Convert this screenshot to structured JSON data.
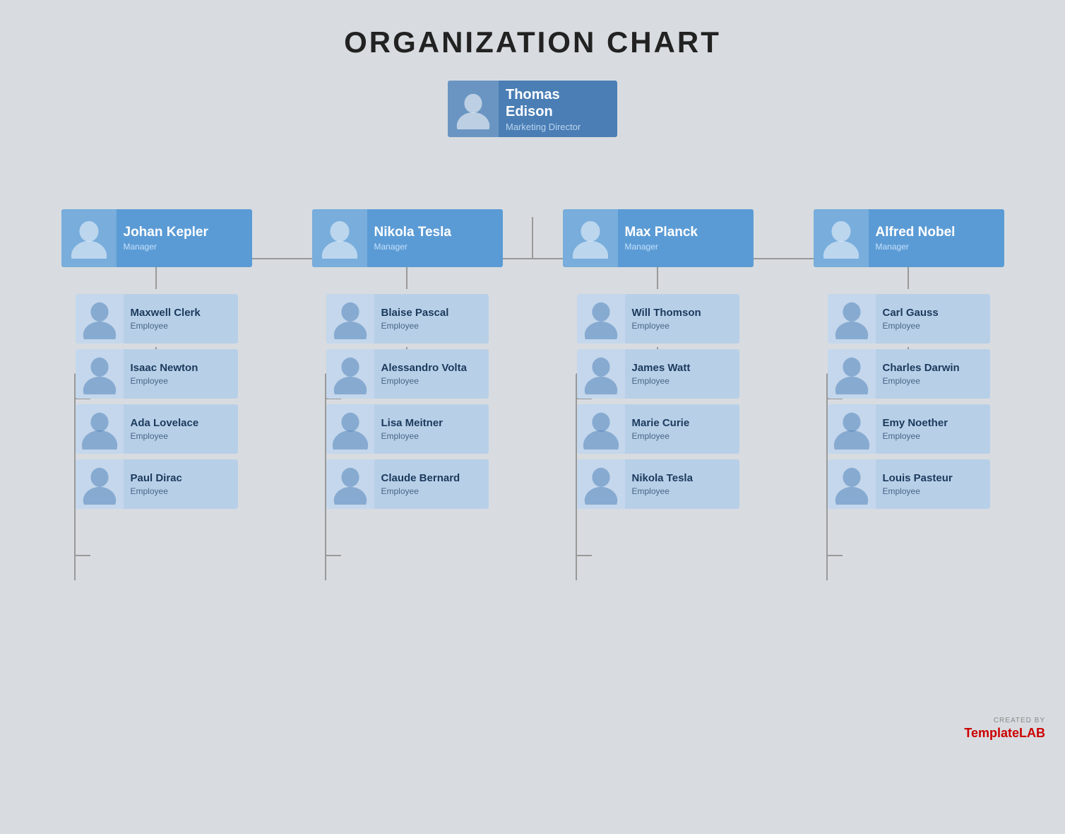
{
  "title": "ORGANIZATION CHART",
  "top": {
    "name": "Thomas Edison",
    "role": "Marketing Director"
  },
  "managers": [
    {
      "name": "Johan Kepler",
      "role": "Manager"
    },
    {
      "name": "Nikola Tesla",
      "role": "Manager"
    },
    {
      "name": "Max Planck",
      "role": "Manager"
    },
    {
      "name": "Alfred Nobel",
      "role": "Manager"
    }
  ],
  "employees": [
    [
      {
        "name": "Maxwell Clerk",
        "role": "Employee"
      },
      {
        "name": "Isaac Newton",
        "role": "Employee"
      },
      {
        "name": "Ada Lovelace",
        "role": "Employee"
      },
      {
        "name": "Paul Dirac",
        "role": "Employee"
      }
    ],
    [
      {
        "name": "Blaise Pascal",
        "role": "Employee"
      },
      {
        "name": "Alessandro Volta",
        "role": "Employee"
      },
      {
        "name": "Lisa Meitner",
        "role": "Employee"
      },
      {
        "name": "Claude Bernard",
        "role": "Employee"
      }
    ],
    [
      {
        "name": "Will Thomson",
        "role": "Employee"
      },
      {
        "name": "James Watt",
        "role": "Employee"
      },
      {
        "name": "Marie Curie",
        "role": "Employee"
      },
      {
        "name": "Nikola Tesla",
        "role": "Employee"
      }
    ],
    [
      {
        "name": "Carl Gauss",
        "role": "Employee"
      },
      {
        "name": "Charles Darwin",
        "role": "Employee"
      },
      {
        "name": "Emy Noether",
        "role": "Employee"
      },
      {
        "name": "Louis Pasteur",
        "role": "Employee"
      }
    ]
  ],
  "watermark": {
    "created": "CREATED BY",
    "brand": "Template",
    "brand_colored": "LAB"
  }
}
